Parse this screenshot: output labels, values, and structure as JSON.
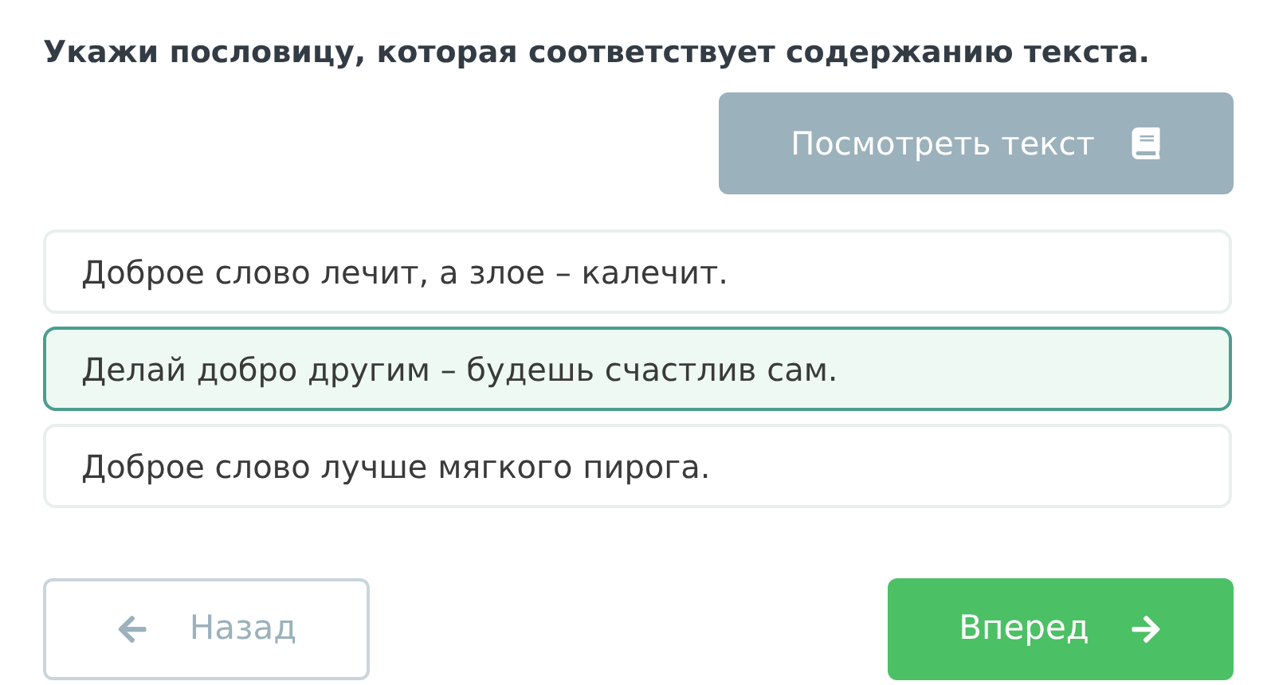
{
  "question": "Укажи пословицу, которая соответствует содержанию текста.",
  "view_text_button": "Посмотреть текст",
  "options": [
    {
      "label": "Доброе слово лечит, а злое – калечит.",
      "selected": false
    },
    {
      "label": "Делай добро другим – будешь счастлив сам.",
      "selected": true
    },
    {
      "label": "Доброе слово лучше мягкого пирога.",
      "selected": false
    }
  ],
  "back_button": "Назад",
  "next_button": "Вперед"
}
